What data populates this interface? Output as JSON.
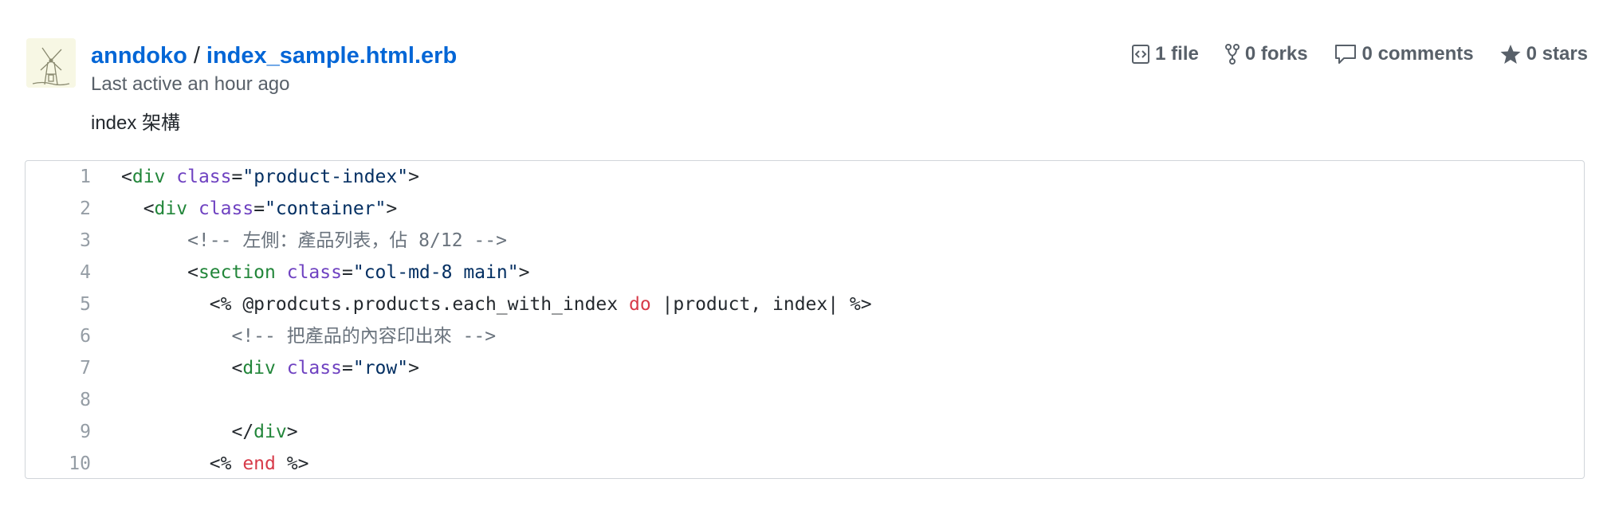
{
  "header": {
    "owner": "anndoko",
    "separator": "/",
    "filename": "index_sample.html.erb",
    "last_active": "Last active an hour ago",
    "description": "index 架構"
  },
  "stats": [
    {
      "label": "1 file",
      "icon": "code-file-icon"
    },
    {
      "label": "0 forks",
      "icon": "fork-icon"
    },
    {
      "label": "0 comments",
      "icon": "comment-icon"
    },
    {
      "label": "0 stars",
      "icon": "star-icon"
    }
  ],
  "code": {
    "line_numbers": [
      "1",
      "2",
      "3",
      "4",
      "5",
      "6",
      "7",
      "8",
      "9",
      "10"
    ],
    "lines": [
      [
        {
          "t": "<"
        },
        {
          "t": "div",
          "c": "tag"
        },
        {
          "t": " "
        },
        {
          "t": "class",
          "c": "attr"
        },
        {
          "t": "="
        },
        {
          "t": "\"product-index\"",
          "c": "str"
        },
        {
          "t": ">"
        }
      ],
      [
        {
          "t": "  <"
        },
        {
          "t": "div",
          "c": "tag"
        },
        {
          "t": " "
        },
        {
          "t": "class",
          "c": "attr"
        },
        {
          "t": "="
        },
        {
          "t": "\"container\"",
          "c": "str"
        },
        {
          "t": ">"
        }
      ],
      [
        {
          "t": "      <!-- 左側：產品列表，佔 8/12 -->",
          "c": "comment"
        }
      ],
      [
        {
          "t": "      <"
        },
        {
          "t": "section",
          "c": "tag"
        },
        {
          "t": " "
        },
        {
          "t": "class",
          "c": "attr"
        },
        {
          "t": "="
        },
        {
          "t": "\"col-md-8 main\"",
          "c": "str"
        },
        {
          "t": ">"
        }
      ],
      [
        {
          "t": "        <% @prodcuts.products.each_with_index "
        },
        {
          "t": "do",
          "c": "kw"
        },
        {
          "t": " |product, index| %>"
        }
      ],
      [
        {
          "t": "          <!-- 把產品的內容印出來 -->",
          "c": "comment"
        }
      ],
      [
        {
          "t": "          <"
        },
        {
          "t": "div",
          "c": "tag"
        },
        {
          "t": " "
        },
        {
          "t": "class",
          "c": "attr"
        },
        {
          "t": "="
        },
        {
          "t": "\"row\"",
          "c": "str"
        },
        {
          "t": ">"
        }
      ],
      [
        {
          "t": ""
        }
      ],
      [
        {
          "t": "          </"
        },
        {
          "t": "div",
          "c": "tag"
        },
        {
          "t": ">"
        }
      ],
      [
        {
          "t": "        <% "
        },
        {
          "t": "end",
          "c": "kw"
        },
        {
          "t": " %>"
        }
      ]
    ]
  }
}
